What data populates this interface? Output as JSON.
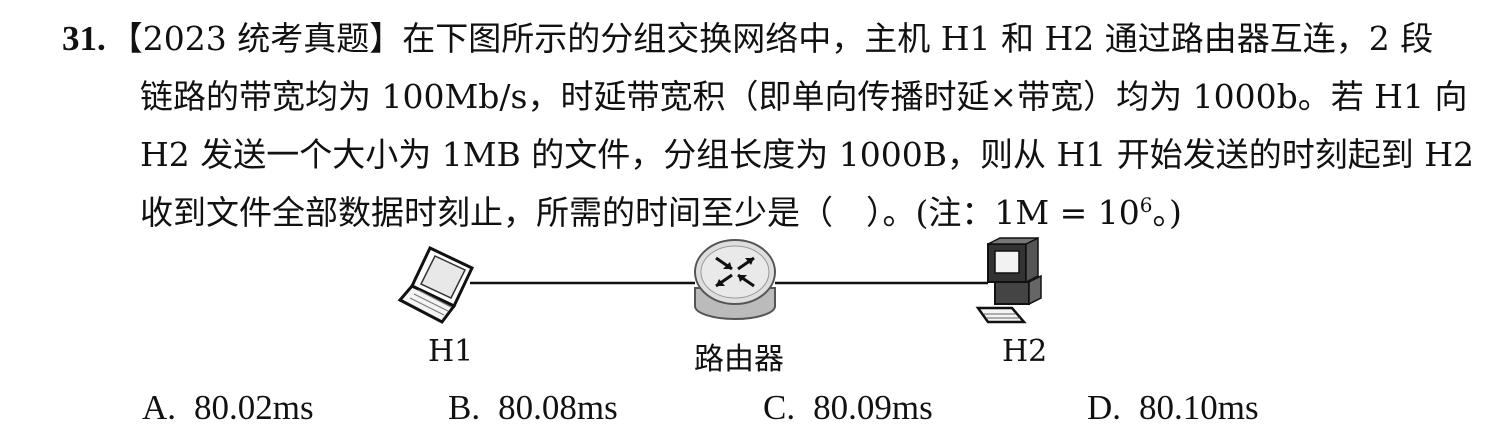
{
  "question": {
    "number": "31.",
    "lines": [
      "【2023 统考真题】在下图所示的分组交换网络中，主机 H1 和 H2 通过路由器互连，2 段",
      "链路的带宽均为 100Mb/s，时延带宽积（即单向传播时延×带宽）均为 1000b。若 H1 向",
      "H2 发送一个大小为 1MB 的文件，分组长度为 1000B，则从 H1 开始发送的时刻起到 H2"
    ],
    "last_line_pre": "收到文件全部数据时刻止，所需的时间至少是（　）。(注：1M = 10",
    "last_line_sup": "6",
    "last_line_post": "。)"
  },
  "diagram": {
    "h1_label": "H1",
    "router_label": "路由器",
    "h2_label": "H2",
    "h1_icon": "laptop-icon",
    "router_icon": "router-icon",
    "h2_icon": "desktop-computer-icon"
  },
  "options": [
    {
      "letter": "A.",
      "text": "80.02ms"
    },
    {
      "letter": "B.",
      "text": "80.08ms"
    },
    {
      "letter": "C.",
      "text": "80.09ms"
    },
    {
      "letter": "D.",
      "text": "80.10ms"
    }
  ]
}
